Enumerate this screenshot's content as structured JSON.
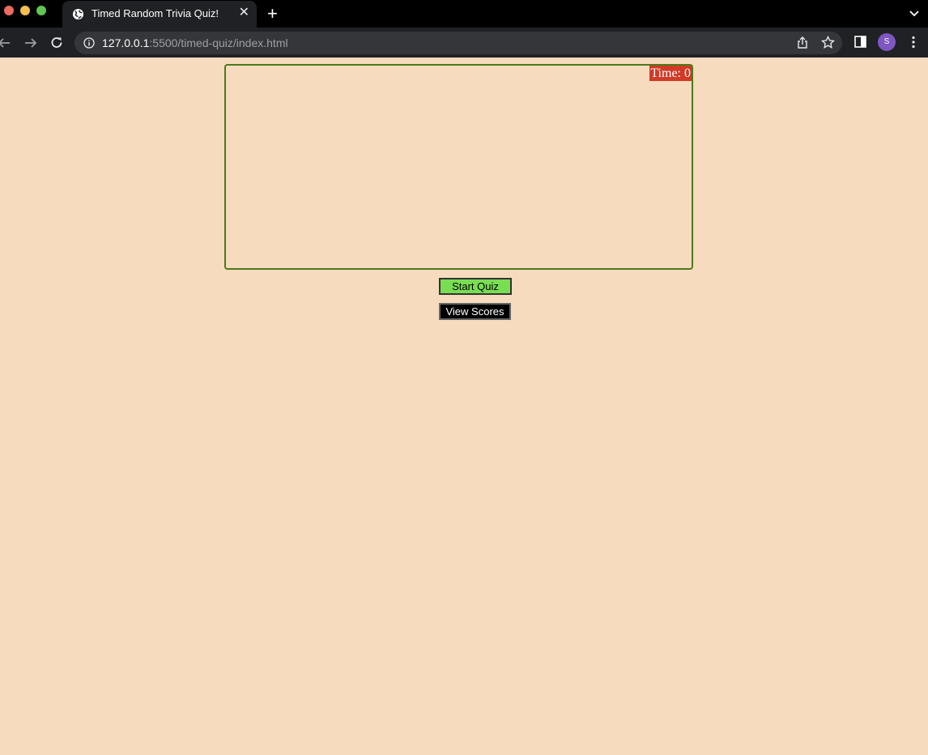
{
  "browser": {
    "tab_title": "Timed Random Trivia Quiz!",
    "url_host": "127.0.0.1",
    "url_rest": ":5500/timed-quiz/index.html",
    "profile_initial": "S"
  },
  "quiz": {
    "timer_text": "Time: 0",
    "start_label": "Start Quiz",
    "scores_label": "View Scores"
  },
  "colors": {
    "page_background": "#f6dbbe",
    "box_border": "#4b7a1c",
    "timer_background": "#d13a26",
    "start_button": "#79dd52",
    "scores_button": "#000000"
  }
}
